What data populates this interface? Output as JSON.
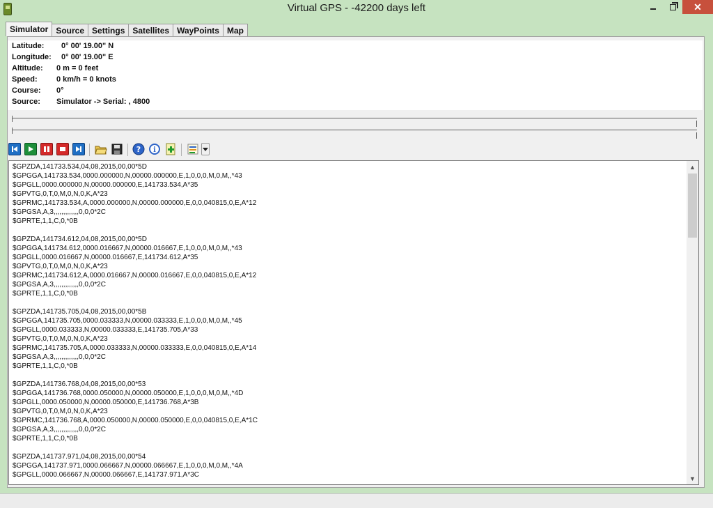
{
  "window": {
    "title": "Virtual GPS - -42200 days left"
  },
  "tabs": [
    {
      "label": "Simulator",
      "active": true
    },
    {
      "label": "Source",
      "active": false
    },
    {
      "label": "Settings",
      "active": false
    },
    {
      "label": "Satellites",
      "active": false
    },
    {
      "label": "WayPoints",
      "active": false
    },
    {
      "label": "Map",
      "active": false
    }
  ],
  "info": [
    {
      "label": "Latitude:",
      "value": "0° 00' 19.00\" N"
    },
    {
      "label": "Longitude:",
      "value": "0° 00' 19.00\" E"
    },
    {
      "label": "Altitude:",
      "value": "0 m = 0 feet"
    },
    {
      "label": "Speed:",
      "value": "0 km/h = 0 knots"
    },
    {
      "label": "Course:",
      "value": "0°"
    },
    {
      "label": "Source:",
      "value": "Simulator -> Serial: , 4800"
    }
  ],
  "toolbar": [
    {
      "name": "skip-back-button",
      "icon": "skip-back-icon"
    },
    {
      "name": "play-button",
      "icon": "play-icon"
    },
    {
      "name": "pause-button",
      "icon": "pause-icon"
    },
    {
      "name": "stop-button",
      "icon": "stop-icon"
    },
    {
      "name": "skip-forward-button",
      "icon": "skip-forward-icon"
    },
    {
      "name": "open-file-button",
      "icon": "folder-open-icon"
    },
    {
      "name": "save-button",
      "icon": "floppy-disk-icon"
    },
    {
      "name": "help-button",
      "icon": "help-icon"
    },
    {
      "name": "info-button",
      "icon": "info-icon"
    },
    {
      "name": "add-button",
      "icon": "add-document-icon"
    },
    {
      "name": "options-button",
      "icon": "list-options-icon"
    },
    {
      "name": "options-dropdown-button",
      "icon": "chevron-down-icon"
    }
  ],
  "nmea_lines": [
    "$GPZDA,141733.534,04,08,2015,00,00*5D",
    "$GPGGA,141733.534,0000.000000,N,00000.000000,E,1,0,0,0,M,0,M,,*43",
    "$GPGLL,0000.000000,N,00000.000000,E,141733.534,A*35",
    "$GPVTG,0,T,0,M,0,N,0,K,A*23",
    "$GPRMC,141733.534,A,0000.000000,N,00000.000000,E,0,0,040815,0,E,A*12",
    "$GPGSA,A,3,,,,,,,,,,,,,0,0,0*2C",
    "$GPRTE,1,1,C,0,*0B",
    "",
    "$GPZDA,141734.612,04,08,2015,00,00*5D",
    "$GPGGA,141734.612,0000.016667,N,00000.016667,E,1,0,0,0,M,0,M,,*43",
    "$GPGLL,0000.016667,N,00000.016667,E,141734.612,A*35",
    "$GPVTG,0,T,0,M,0,N,0,K,A*23",
    "$GPRMC,141734.612,A,0000.016667,N,00000.016667,E,0,0,040815,0,E,A*12",
    "$GPGSA,A,3,,,,,,,,,,,,,0,0,0*2C",
    "$GPRTE,1,1,C,0,*0B",
    "",
    "$GPZDA,141735.705,04,08,2015,00,00*5B",
    "$GPGGA,141735.705,0000.033333,N,00000.033333,E,1,0,0,0,M,0,M,,*45",
    "$GPGLL,0000.033333,N,00000.033333,E,141735.705,A*33",
    "$GPVTG,0,T,0,M,0,N,0,K,A*23",
    "$GPRMC,141735.705,A,0000.033333,N,00000.033333,E,0,0,040815,0,E,A*14",
    "$GPGSA,A,3,,,,,,,,,,,,,0,0,0*2C",
    "$GPRTE,1,1,C,0,*0B",
    "",
    "$GPZDA,141736.768,04,08,2015,00,00*53",
    "$GPGGA,141736.768,0000.050000,N,00000.050000,E,1,0,0,0,M,0,M,,*4D",
    "$GPGLL,0000.050000,N,00000.050000,E,141736.768,A*3B",
    "$GPVTG,0,T,0,M,0,N,0,K,A*23",
    "$GPRMC,141736.768,A,0000.050000,N,00000.050000,E,0,0,040815,0,E,A*1C",
    "$GPGSA,A,3,,,,,,,,,,,,,0,0,0*2C",
    "$GPRTE,1,1,C,0,*0B",
    "",
    "$GPZDA,141737.971,04,08,2015,00,00*54",
    "$GPGGA,141737.971,0000.066667,N,00000.066667,E,1,0,0,0,M,0,M,,*4A",
    "$GPGLL,0000.066667,N,00000.066667,E,141737.971,A*3C"
  ]
}
